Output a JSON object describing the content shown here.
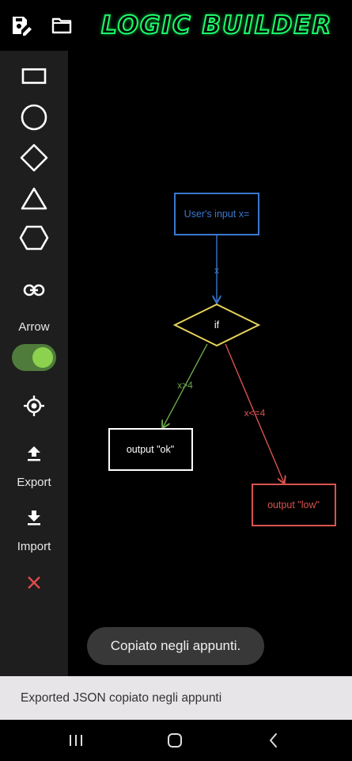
{
  "app": {
    "title": "Logic Builder"
  },
  "sidebar": {
    "arrow_label": "Arrow",
    "arrow_toggle_on": true,
    "export_label": "Export",
    "import_label": "Import"
  },
  "diagram": {
    "input_node": "User's input x=",
    "edge_x": "x",
    "decision_node": "if",
    "edge_gt": "x>4",
    "edge_le": "x<=4",
    "output_ok": "output \"ok\"",
    "output_low": "output \"low\""
  },
  "toast": {
    "message": "Copiato negli appunti."
  },
  "snackbar": {
    "message": "Exported JSON copiato negli appunti"
  },
  "colors": {
    "blue": "#3a78d0",
    "yellow": "#e6d35a",
    "green": "#6ba74a",
    "red": "#d9534f",
    "logo_green": "#1dfc6a"
  }
}
